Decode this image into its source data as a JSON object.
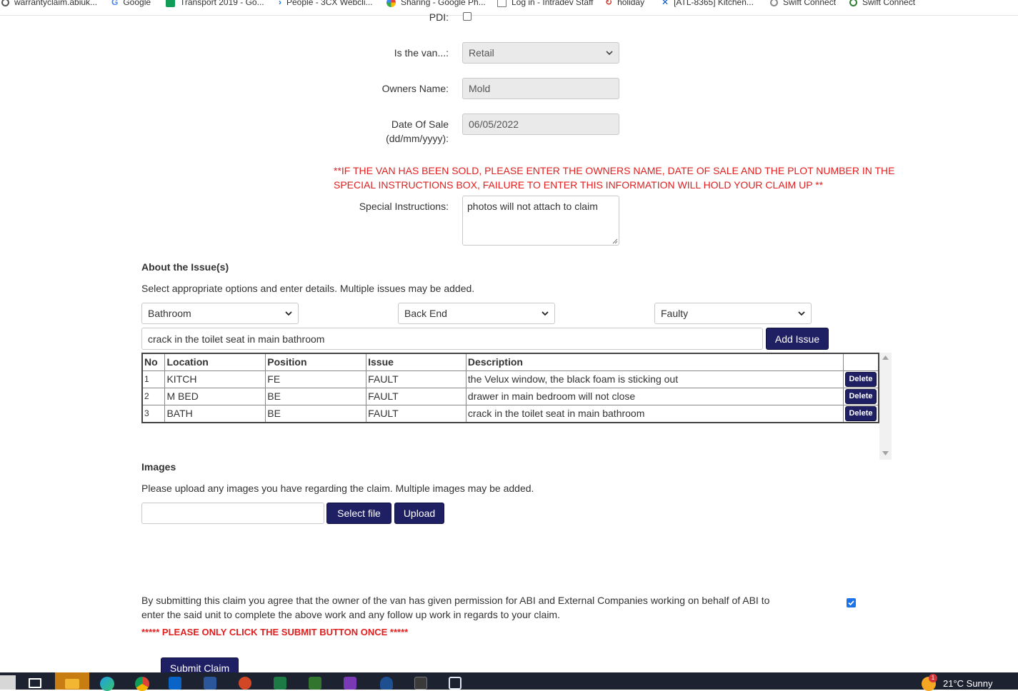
{
  "bookmarks": [
    {
      "label": "warrantyclaim.abiuk...",
      "icon": "globe-icon",
      "color": "#555555"
    },
    {
      "label": "Google",
      "icon": "google-icon",
      "color": "#4285f4"
    },
    {
      "label": "Transport 2019 - Go...",
      "icon": "sheets-icon",
      "color": "#0f9d58"
    },
    {
      "label": "People - 3CX Webcli...",
      "icon": "chevron-icon",
      "color": "#1a73e8"
    },
    {
      "label": "Sharing - Google Ph...",
      "icon": "photos-icon",
      "color": "#f4b400"
    },
    {
      "label": "Log in - Intradev Staff",
      "icon": "doc-icon",
      "color": "#777777"
    },
    {
      "label": "holiday",
      "icon": "refresh-icon",
      "color": "#d93025"
    },
    {
      "label": "[ATL-8365] Kitchen...",
      "icon": "jira-icon",
      "color": "#0052cc"
    },
    {
      "label": "Swift Connect",
      "icon": "globe-icon",
      "color": "#888888"
    },
    {
      "label": "Swift Connect",
      "icon": "globe-icon",
      "color": "#2e7d32"
    }
  ],
  "form": {
    "pdi_label": "PDI:",
    "van_label": "Is the van...:",
    "van_value": "Retail",
    "owner_label": "Owners Name:",
    "owner_value": "Mold",
    "date_label_1": "Date Of Sale",
    "date_label_2": "(dd/mm/yyyy):",
    "date_value": "06/05/2022",
    "warning_1": "**IF THE VAN HAS BEEN SOLD, PLEASE ENTER THE OWNERS NAME, DATE OF SALE AND THE PLOT NUMBER IN THE",
    "warning_2": "SPECIAL INSTRUCTIONS BOX, FAILURE TO ENTER THIS INFORMATION WILL HOLD YOUR CLAIM UP **",
    "special_label": "Special Instructions:",
    "special_value": "photos will not attach to claim"
  },
  "issues": {
    "heading": "About the Issue(s)",
    "intro": "Select appropriate options and enter details. Multiple issues may be added.",
    "location_select": "Bathroom",
    "position_select": "Back End",
    "issue_select": "Faulty",
    "description_value": "crack in the toilet seat in main bathroom",
    "add_label": "Add Issue",
    "columns": [
      "No",
      "Location",
      "Position",
      "Issue",
      "Description",
      ""
    ],
    "delete_label": "Delete",
    "rows": [
      {
        "no": "1",
        "location": "KITCH",
        "position": "FE",
        "issue": "FAULT",
        "description": "the Velux window, the black foam is sticking out"
      },
      {
        "no": "2",
        "location": "M BED",
        "position": "BE",
        "issue": "FAULT",
        "description": "drawer in main bedroom will not close"
      },
      {
        "no": "3",
        "location": "BATH",
        "position": "BE",
        "issue": "FAULT",
        "description": "crack in the toilet seat in main bathroom"
      }
    ]
  },
  "images": {
    "heading": "Images",
    "intro": "Please upload any images you have regarding the claim. Multiple images may be added.",
    "select_label": "Select file",
    "upload_label": "Upload"
  },
  "consent": {
    "text_1": "By submitting this claim you agree that the owner of the van has given permission for ABI and External Companies working on behalf of ABI to",
    "text_2": "enter the said unit to complete the above work and any follow up work in regards to your claim.",
    "checked": true,
    "warning": "***** PLEASE ONLY CLICK THE SUBMIT BUTTON ONCE *****",
    "submit_label": "Submit Claim"
  },
  "taskbar": {
    "weather": "21°C  Sunny",
    "notification_count": "1",
    "apps": [
      "file-explorer-icon",
      "edge-icon",
      "chrome-icon",
      "outlook-icon",
      "word-icon",
      "powerpoint-icon",
      "excel-icon",
      "project-icon",
      "onenote-icon",
      "defender-icon",
      "3cx-icon",
      "box-icon"
    ]
  },
  "colors": {
    "button": "#1f1f63",
    "warning": "#e02020",
    "checkbox": "#1a73e8"
  }
}
